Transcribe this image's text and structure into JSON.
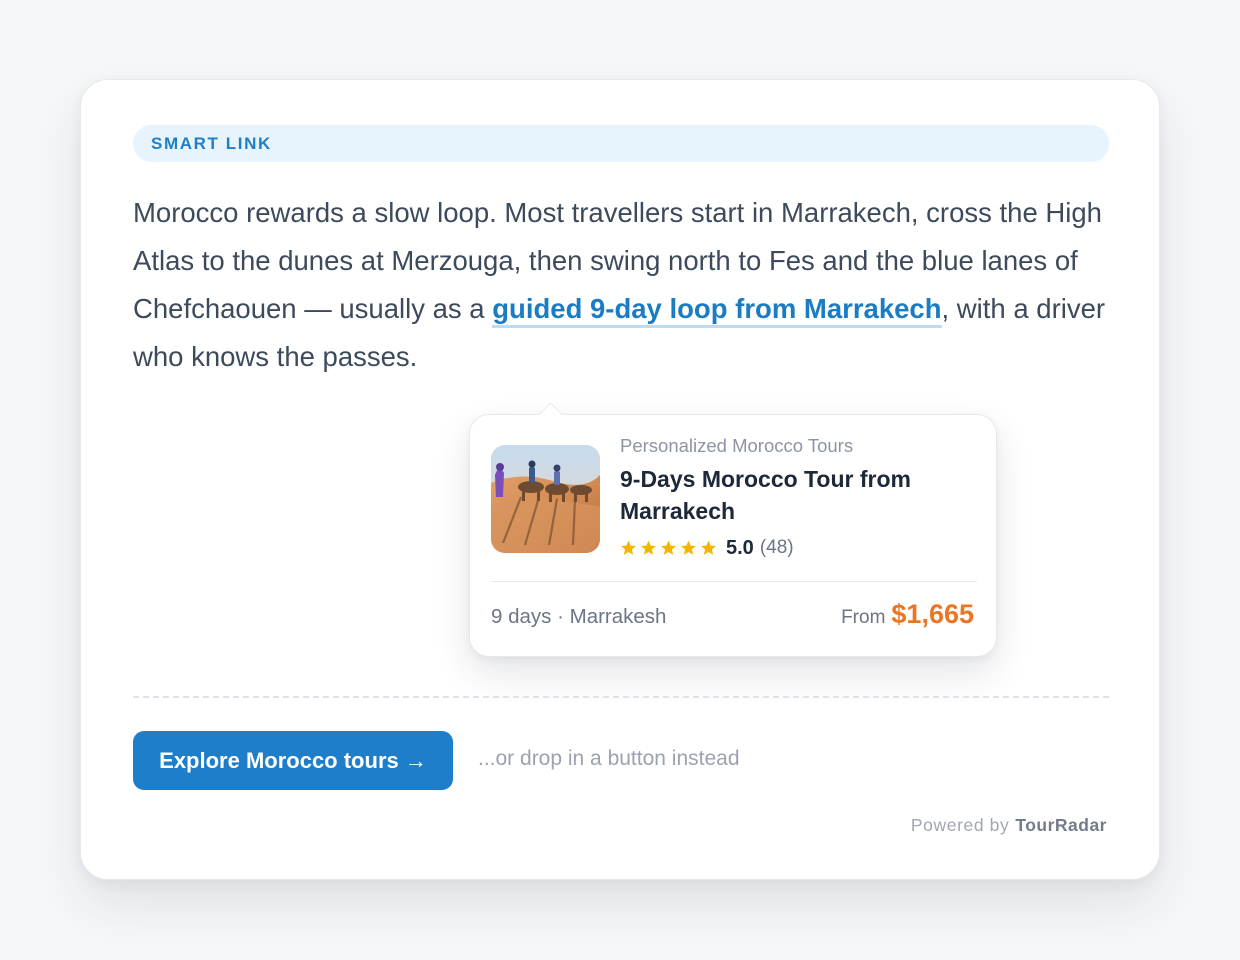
{
  "badge": {
    "label": "SMART LINK"
  },
  "article": {
    "text_before": "Morocco rewards a slow loop. Most travellers start in Marrakech, cross the High Atlas to the dunes at Merzouga, then swing north to Fes and the blue lanes of Chefchaouen — usually as a ",
    "link_text": "guided 9-day loop from Marrakech",
    "text_after": ", with a driver who knows the passes."
  },
  "tour_card": {
    "operator": "Personalized Morocco Tours",
    "title": "9-Days Morocco Tour from Marrakech",
    "image_icon": "desert-camel-photo",
    "rating": {
      "stars": 5,
      "value": "5.0",
      "count": "(48)"
    },
    "meta": "9 days · Marrakesh",
    "price_prefix": "From",
    "price": "$1,665"
  },
  "cta": {
    "label": "Explore Morocco tours →",
    "alt_note": "...or drop in a button instead"
  },
  "footer": {
    "powered_label": "Powered by",
    "brand": "TourRadar"
  },
  "colors": {
    "accent": "#1e7ec9",
    "link": "#1a7cc4",
    "badge_bg": "#e7f3fd",
    "price": "#ea7524",
    "star": "#f5b400"
  }
}
